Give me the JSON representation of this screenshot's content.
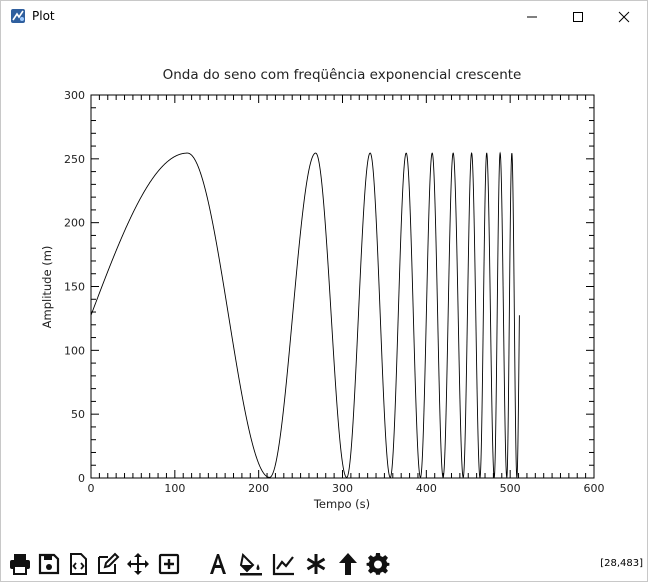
{
  "window": {
    "title": "Plot",
    "icons": [
      "app-icon",
      "minimize-icon",
      "maximize-icon",
      "close-icon"
    ]
  },
  "toolbar": {
    "icons": [
      "print-icon",
      "save-icon",
      "code-icon",
      "edit-icon",
      "move-icon",
      "add-icon",
      "text-icon",
      "fill-icon",
      "line-chart-icon",
      "asterisk-icon",
      "arrow-up-icon",
      "gear-icon"
    ],
    "coords": "[28,483]"
  },
  "colors": {
    "line": "#000000",
    "background": "#ffffff"
  },
  "chart_data": {
    "type": "line",
    "title": "Onda do seno com freqüência exponencial crescente",
    "xlabel": "Tempo (s)",
    "ylabel": "Amplitude (m)",
    "xlim": [
      0,
      600
    ],
    "ylim": [
      0,
      300
    ],
    "xticks": [
      0,
      100,
      200,
      300,
      400,
      500,
      600
    ],
    "yticks": [
      0,
      50,
      100,
      150,
      200,
      250,
      300
    ],
    "grid": false,
    "series": [
      {
        "x_start": 0,
        "x_end": 511,
        "y_offset": 127.5,
        "amplitude": 127,
        "phase_start": 0,
        "peaks_x": [
          115,
          268,
          333,
          376,
          407,
          432,
          454,
          472,
          488,
          502
        ],
        "troughs_x": [
          213,
          305,
          357,
          393,
          420,
          444,
          464,
          481,
          496,
          508
        ]
      }
    ]
  }
}
